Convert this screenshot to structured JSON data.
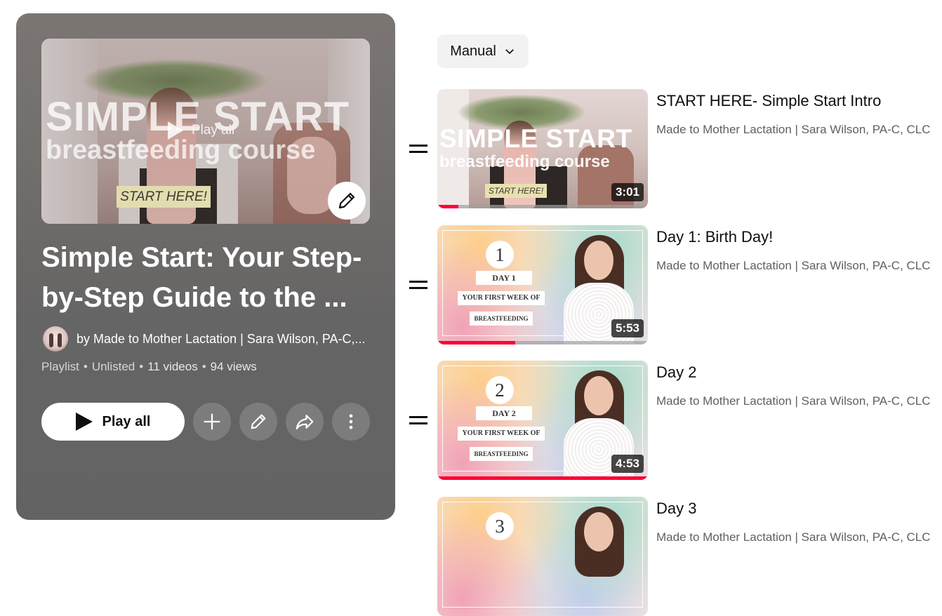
{
  "playlist": {
    "thumb_title_line1": "SIMPLE START",
    "thumb_title_line2": "breastfeeding course",
    "thumb_badge": "START HERE!",
    "thumb_play_all": "Play all",
    "title": "Simple Start: Your Step-by-Step Guide to the ...",
    "title_line1": "Simple Start: Your Step-",
    "title_line2": "by-Step Guide to the ...",
    "owner": "by Made to Mother Lactation | Sara Wilson, PA-C,...",
    "meta": {
      "type": "Playlist",
      "visibility": "Unlisted",
      "videos": "11 videos",
      "views": "94 views",
      "separator": "•"
    },
    "play_all_label": "Play all",
    "icons": {
      "add": "plus-icon",
      "edit": "pencil-icon",
      "share": "share-icon",
      "more": "more-vert-icon"
    }
  },
  "sort": {
    "label": "Manual",
    "icon": "chevron-down-icon"
  },
  "videos": [
    {
      "title": "START HERE- Simple Start Intro",
      "channel": "Made to Mother Lactation | Sara Wilson, PA-C, CLC",
      "duration": "3:01",
      "progress": 0.1,
      "thumb": {
        "line1": "SIMPLE START",
        "line2": "breastfeeding course",
        "badge": "START HERE!"
      }
    },
    {
      "title": "Day 1: Birth Day!",
      "channel": "Made to Mother Lactation | Sara Wilson, PA-C, CLC",
      "duration": "5:53",
      "progress": 0.37,
      "thumb": {
        "number": "1",
        "day": "DAY 1",
        "sub": "YOUR FIRST WEEK OF",
        "sub2": "BREASTFEEDING"
      }
    },
    {
      "title": "Day 2",
      "channel": "Made to Mother Lactation | Sara Wilson, PA-C, CLC",
      "duration": "4:53",
      "progress": 1.0,
      "thumb": {
        "number": "2",
        "day": "DAY 2",
        "sub": "YOUR FIRST WEEK OF",
        "sub2": "BREASTFEEDING"
      }
    },
    {
      "title": "Day 3",
      "channel": "Made to Mother Lactation | Sara Wilson, PA-C, CLC",
      "thumb": {
        "number": "3"
      }
    }
  ],
  "colors": {
    "accent": "#ff0033",
    "panel": "#666565",
    "text_secondary": "#606060"
  }
}
